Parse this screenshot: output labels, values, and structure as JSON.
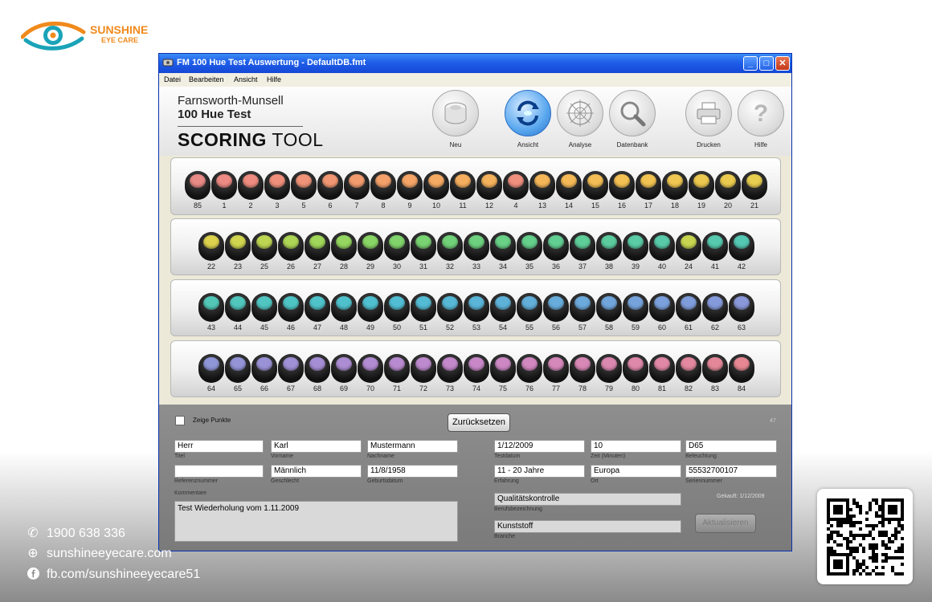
{
  "brand": {
    "name": "SUNSHINE",
    "sub": "EYE CARE"
  },
  "window": {
    "title": "FM 100 Hue Test Auswertung - DefaultDB.fmt"
  },
  "menu": [
    "Datei",
    "Bearbeiten",
    "Ansicht",
    "Hilfe"
  ],
  "app_logo": {
    "line1": "Farnsworth-Munsell",
    "line2": "100 Hue Test",
    "line3_bold": "SCORING",
    "line3_rest": " TOOL"
  },
  "toolbar": [
    {
      "label": "Neu",
      "icon": "cylinder-icon"
    },
    {
      "label": "Ansicht",
      "icon": "refresh-icon",
      "active": true
    },
    {
      "label": "Analyse",
      "icon": "analysis-wheel-icon"
    },
    {
      "label": "Datenbank",
      "icon": "magnifier-icon"
    },
    {
      "label": "Drucken",
      "icon": "printer-icon"
    },
    {
      "label": "Hilfe",
      "icon": "question-icon"
    }
  ],
  "trays": [
    {
      "caps": [
        {
          "n": "85",
          "c": "#e88a86"
        },
        {
          "n": "1",
          "c": "#ec8a84"
        },
        {
          "n": "2",
          "c": "#ee8c80"
        },
        {
          "n": "3",
          "c": "#f08f7c"
        },
        {
          "n": "5",
          "c": "#f09378"
        },
        {
          "n": "6",
          "c": "#f19773"
        },
        {
          "n": "7",
          "c": "#f29b6f"
        },
        {
          "n": "8",
          "c": "#f3a06b"
        },
        {
          "n": "9",
          "c": "#f4a567"
        },
        {
          "n": "10",
          "c": "#f5aa63"
        },
        {
          "n": "11",
          "c": "#f5ae5f"
        },
        {
          "n": "12",
          "c": "#f5b25c"
        },
        {
          "n": "4",
          "c": "#ef8f7e"
        },
        {
          "n": "13",
          "c": "#f5b659"
        },
        {
          "n": "14",
          "c": "#f5ba57"
        },
        {
          "n": "15",
          "c": "#f4be55"
        },
        {
          "n": "16",
          "c": "#f3c153"
        },
        {
          "n": "17",
          "c": "#f1c352"
        },
        {
          "n": "18",
          "c": "#efc651"
        },
        {
          "n": "19",
          "c": "#ecc850"
        },
        {
          "n": "20",
          "c": "#eacb50"
        },
        {
          "n": "21",
          "c": "#e7cd50"
        }
      ]
    },
    {
      "caps": [
        {
          "n": "22",
          "c": "#dcd24e"
        },
        {
          "n": "23",
          "c": "#cfd54f"
        },
        {
          "n": "25",
          "c": "#bcd652"
        },
        {
          "n": "26",
          "c": "#aed656"
        },
        {
          "n": "27",
          "c": "#a0d65a"
        },
        {
          "n": "28",
          "c": "#94d65f"
        },
        {
          "n": "29",
          "c": "#89d565"
        },
        {
          "n": "30",
          "c": "#80d46b"
        },
        {
          "n": "31",
          "c": "#79d372"
        },
        {
          "n": "32",
          "c": "#72d279"
        },
        {
          "n": "33",
          "c": "#6dd17f"
        },
        {
          "n": "34",
          "c": "#69d086"
        },
        {
          "n": "35",
          "c": "#65cf8c"
        },
        {
          "n": "36",
          "c": "#62ce92"
        },
        {
          "n": "37",
          "c": "#5fcd98"
        },
        {
          "n": "38",
          "c": "#5ccc9e"
        },
        {
          "n": "39",
          "c": "#5acba4"
        },
        {
          "n": "40",
          "c": "#58caa9"
        },
        {
          "n": "24",
          "c": "#c7d550"
        },
        {
          "n": "41",
          "c": "#56c9ae"
        },
        {
          "n": "42",
          "c": "#54c8b3"
        }
      ]
    },
    {
      "caps": [
        {
          "n": "43",
          "c": "#52c7b8"
        },
        {
          "n": "44",
          "c": "#51c6bd"
        },
        {
          "n": "45",
          "c": "#50c5c1"
        },
        {
          "n": "46",
          "c": "#4fc4c5"
        },
        {
          "n": "47",
          "c": "#4fc3c9"
        },
        {
          "n": "48",
          "c": "#4fc1cc"
        },
        {
          "n": "49",
          "c": "#50bfcf"
        },
        {
          "n": "50",
          "c": "#52bdd2"
        },
        {
          "n": "51",
          "c": "#54bbd4"
        },
        {
          "n": "52",
          "c": "#57b8d6"
        },
        {
          "n": "53",
          "c": "#5ab5d8"
        },
        {
          "n": "54",
          "c": "#5eb2d9"
        },
        {
          "n": "55",
          "c": "#62afda"
        },
        {
          "n": "56",
          "c": "#67acdb"
        },
        {
          "n": "57",
          "c": "#6ca9dc"
        },
        {
          "n": "58",
          "c": "#71a6dc"
        },
        {
          "n": "59",
          "c": "#76a3dc"
        },
        {
          "n": "60",
          "c": "#7ba0dc"
        },
        {
          "n": "61",
          "c": "#809ddb"
        },
        {
          "n": "62",
          "c": "#859ada"
        },
        {
          "n": "63",
          "c": "#8a98d9"
        }
      ]
    },
    {
      "caps": [
        {
          "n": "64",
          "c": "#8f96d8"
        },
        {
          "n": "65",
          "c": "#9494d7"
        },
        {
          "n": "66",
          "c": "#9a92d6"
        },
        {
          "n": "67",
          "c": "#a090d5"
        },
        {
          "n": "68",
          "c": "#a68ed4"
        },
        {
          "n": "69",
          "c": "#ac8dd3"
        },
        {
          "n": "70",
          "c": "#b28cd2"
        },
        {
          "n": "71",
          "c": "#b88bd0"
        },
        {
          "n": "72",
          "c": "#be8ace"
        },
        {
          "n": "73",
          "c": "#c389cb"
        },
        {
          "n": "74",
          "c": "#c888c8"
        },
        {
          "n": "75",
          "c": "#cd88c4"
        },
        {
          "n": "76",
          "c": "#d188bf"
        },
        {
          "n": "77",
          "c": "#d588ba"
        },
        {
          "n": "78",
          "c": "#d888b5"
        },
        {
          "n": "79",
          "c": "#db88b0"
        },
        {
          "n": "80",
          "c": "#de88aa"
        },
        {
          "n": "81",
          "c": "#e088a5"
        },
        {
          "n": "82",
          "c": "#e2889f"
        },
        {
          "n": "83",
          "c": "#e48899"
        },
        {
          "n": "84",
          "c": "#e68893"
        }
      ]
    }
  ],
  "controls": {
    "show_points_label": "Zeige Punkte",
    "show_points_checked": false,
    "reset_label": "Zurücksetzen",
    "corner": "47"
  },
  "form": {
    "titel": {
      "value": "Herr",
      "label": "Titel"
    },
    "vorname": {
      "value": "Karl",
      "label": "Vorname"
    },
    "nachname": {
      "value": "Mustermann",
      "label": "Nachname"
    },
    "referenz": {
      "value": "",
      "label": "Referenznummer"
    },
    "geschlecht": {
      "value": "Männlich",
      "label": "Geschlecht"
    },
    "geburtsdatum": {
      "value": "11/8/1958",
      "label": "Geburtsdatum"
    },
    "kommentare_label": "Kommentare",
    "kommentare": "Test Wiederholung vom 1.11.2009",
    "testdatum": {
      "value": "1/12/2009",
      "label": "Testdatum"
    },
    "zeit": {
      "value": "10",
      "label": "Zeit (Minuten)"
    },
    "beleuchtung": {
      "value": "D65",
      "label": "Beleuchtung"
    },
    "erfahrung": {
      "value": "11 - 20 Jahre",
      "label": "Erfahrung"
    },
    "ort": {
      "value": "Europa",
      "label": "Ort"
    },
    "seriennummer": {
      "value": "55532700107",
      "label": "Seriennummer"
    },
    "beruf": {
      "value": "Qualitätskontrolle",
      "label": "Berufsbezeichnung"
    },
    "branche": {
      "value": "Kunststoff",
      "label": "Branche"
    },
    "gekauft": "Gekauft: 1/12/2009",
    "aktualisieren": "Aktualisieren"
  },
  "contacts": [
    {
      "icon": "phone-icon",
      "text": "1900 638 336"
    },
    {
      "icon": "globe-icon",
      "text": "sunshineeyecare.com"
    },
    {
      "icon": "facebook-icon",
      "text": "fb.com/sunshineeyecare51"
    }
  ]
}
